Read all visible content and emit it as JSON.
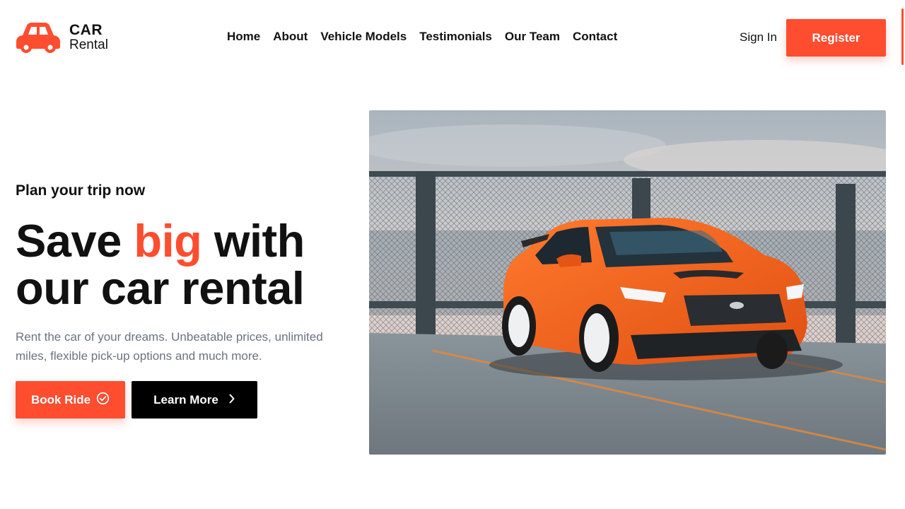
{
  "brand": {
    "line1": "CAR",
    "line2": "Rental",
    "icon": "car-icon",
    "accent_color": "#ff4d30"
  },
  "nav": {
    "items": [
      {
        "label": "Home"
      },
      {
        "label": "About"
      },
      {
        "label": "Vehicle Models"
      },
      {
        "label": "Testimonials"
      },
      {
        "label": "Our Team"
      },
      {
        "label": "Contact"
      }
    ],
    "sign_in": "Sign In",
    "register": "Register"
  },
  "hero": {
    "eyebrow": "Plan your trip now",
    "title_part1": "Save ",
    "title_accent": "big",
    "title_part2": " with our car rental",
    "description": "Rent the car of your dreams. Unbeatable prices, unlimited miles, flexible pick-up options and much more.",
    "book_button": "Book Ride",
    "book_icon": "check-circle-icon",
    "learn_button": "Learn More",
    "learn_icon": "chevron-right-icon",
    "image_subject": "orange sedan parked on rooftop lot"
  }
}
